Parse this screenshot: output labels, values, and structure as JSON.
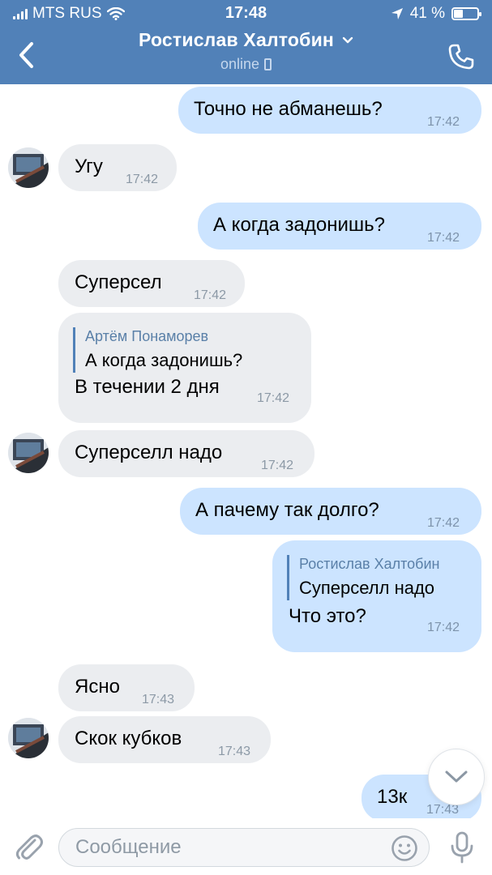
{
  "status_bar": {
    "carrier": "MTS RUS",
    "time": "17:48",
    "battery": "41 %",
    "battery_level": 0.41
  },
  "header": {
    "contact_name": "Ростислав Халтобин",
    "status": "online",
    "accent_color": "#5181b8"
  },
  "messages": [
    {
      "dir": "out",
      "text": "Точно не абманешь?",
      "time": "17:42"
    },
    {
      "dir": "in",
      "text": "Угу",
      "time": "17:42",
      "avatar": true
    },
    {
      "dir": "out",
      "text": "А когда задонишь?",
      "time": "17:42"
    },
    {
      "dir": "in",
      "text": "Суперсел",
      "time": "17:42"
    },
    {
      "dir": "in",
      "reply_author": "Артём Понаморев",
      "reply_text": "А когда задонишь?",
      "text": "В течении 2 дня",
      "time": "17:42"
    },
    {
      "dir": "in",
      "text": "Суперселл надо",
      "time": "17:42",
      "avatar": true
    },
    {
      "dir": "out",
      "text": "А пачему так долго?",
      "time": "17:42"
    },
    {
      "dir": "out",
      "reply_author": "Ростислав Халтобин",
      "reply_text": "Суперселл надо",
      "text": "Что это?",
      "time": "17:42"
    },
    {
      "dir": "in",
      "text": "Ясно",
      "time": "17:43"
    },
    {
      "dir": "in",
      "text": "Скок кубков",
      "time": "17:43",
      "avatar": true
    },
    {
      "dir": "out",
      "text": "13к",
      "time": "17:43"
    }
  ],
  "composer": {
    "placeholder": "Сообщение"
  },
  "icons": {
    "back": "chevron-left-icon",
    "dropdown": "chevron-down-icon",
    "call": "phone-call-icon",
    "attach": "paperclip-icon",
    "emoji": "smiley-icon",
    "mic": "microphone-icon",
    "scroll": "chevron-down-icon"
  }
}
